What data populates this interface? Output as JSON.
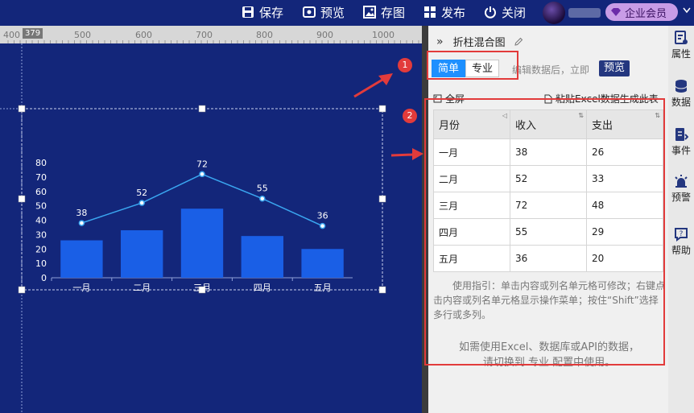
{
  "toolbar": {
    "save": "保存",
    "preview": "预览",
    "save_image": "存图",
    "publish": "发布",
    "close": "关闭",
    "membership": "企业会员"
  },
  "ruler": {
    "corner": "379",
    "marks": [
      "400",
      "500",
      "600",
      "700",
      "800",
      "900",
      "1000"
    ]
  },
  "panel": {
    "title": "折柱混合图",
    "modes": [
      "简单",
      "专业"
    ],
    "hint": "编辑数据后，立即",
    "preview_button": "预览",
    "fullscreen": "全屏",
    "paste_excel": "粘贴Excel数据生成此表",
    "table": {
      "headers": [
        "月份",
        "收入",
        "支出"
      ],
      "rows": [
        [
          "一月",
          "38",
          "26"
        ],
        [
          "二月",
          "52",
          "33"
        ],
        [
          "三月",
          "72",
          "48"
        ],
        [
          "四月",
          "55",
          "29"
        ],
        [
          "五月",
          "36",
          "20"
        ]
      ]
    },
    "guide": "使用指引：单击内容或列名单元格可修改；右键点击内容或列名单元格显示操作菜单；按住“Shift”选择多行或多列。",
    "footer_line1": "如需使用Excel、数据库或API的数据，",
    "footer_line2": "请切换到 专业 配置中使用。"
  },
  "annotations": {
    "badge1": "1",
    "badge2": "2"
  },
  "sidebar": {
    "items": [
      "属性",
      "数据",
      "事件",
      "预警",
      "帮助"
    ]
  },
  "chart_data": {
    "type": "bar",
    "categories": [
      "一月",
      "二月",
      "三月",
      "四月",
      "五月"
    ],
    "series": [
      {
        "type": "line",
        "values": [
          38,
          52,
          72,
          55,
          36
        ],
        "color": "#3aa6f0"
      },
      {
        "type": "bar",
        "values": [
          26,
          33,
          48,
          29,
          20
        ],
        "color": "#1a5fe6"
      }
    ],
    "yticks": [
      "0",
      "10",
      "20",
      "30",
      "40",
      "50",
      "60",
      "70",
      "80"
    ],
    "ylim": [
      0,
      80
    ],
    "grid": false,
    "legend": "none"
  },
  "colors": {
    "canvas_bg": "#13267a",
    "accent": "#1e90ff",
    "highlight": "#e23b3b"
  }
}
